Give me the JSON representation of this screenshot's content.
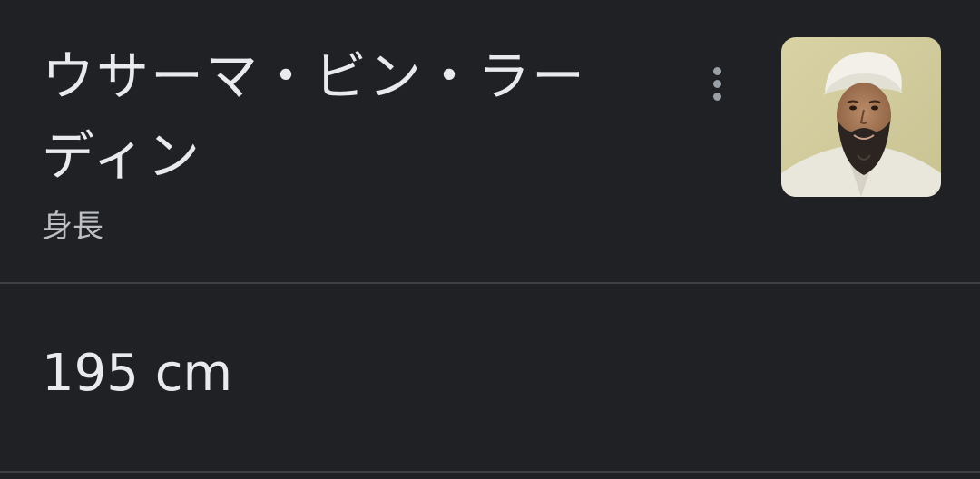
{
  "header": {
    "title_line1": "ウサーマ・ビン・ラー",
    "title_line2": "ディン",
    "subtitle": "身長"
  },
  "answer": {
    "value": "195 cm"
  },
  "icons": {
    "menu": "more-vert-icon",
    "thumbnail": "person-thumbnail"
  },
  "colors": {
    "background": "#202124",
    "text_primary": "#e8eaed",
    "text_secondary": "#bdc1c6",
    "divider": "#3c4043",
    "icon": "#9aa0a6"
  }
}
